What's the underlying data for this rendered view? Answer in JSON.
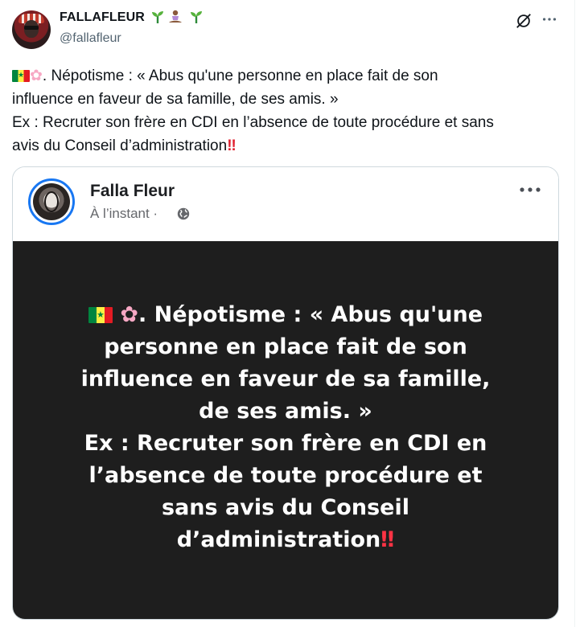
{
  "author": {
    "name": "FALLAFLEUR",
    "name_emoji": "🌱🧘🏾‍♀️🌱",
    "handle": "@fallafleur",
    "avatar_icon": "profile-photo"
  },
  "header_icons": {
    "grok": "grok-icon",
    "more": "more-horizontal-icon"
  },
  "tweet": {
    "line1_prefix": "🇸🇳🌸",
    "line1": ". Népotisme : « Abus qu'une personne en place fait de son",
    "line2": "influence en faveur de sa famille, de ses amis. »",
    "line3": "Ex : Recruter son frère en CDI en l’absence de toute procédure  et sans",
    "line4": "avis du Conseil d’administration",
    "emphasis": "‼️"
  },
  "embedded_post": {
    "author_name": "Falla Fleur",
    "timestamp": "À l’instant ·",
    "privacy_icon": "globe-icon",
    "background": "#1e1e1e",
    "text_color": "#ffffff",
    "lines": [
      ". Népotisme : « Abus qu'une",
      "personne en place fait de son",
      "influence en faveur de sa famille,",
      "de ses amis. »",
      "Ex : Recruter son frère en CDI en",
      "l’absence de toute procédure  et",
      "sans avis du Conseil",
      "d’administration"
    ]
  },
  "colors": {
    "accent_blue": "#1877f2",
    "secondary_text": "#536471",
    "emphasis_red": "#e0202f"
  }
}
